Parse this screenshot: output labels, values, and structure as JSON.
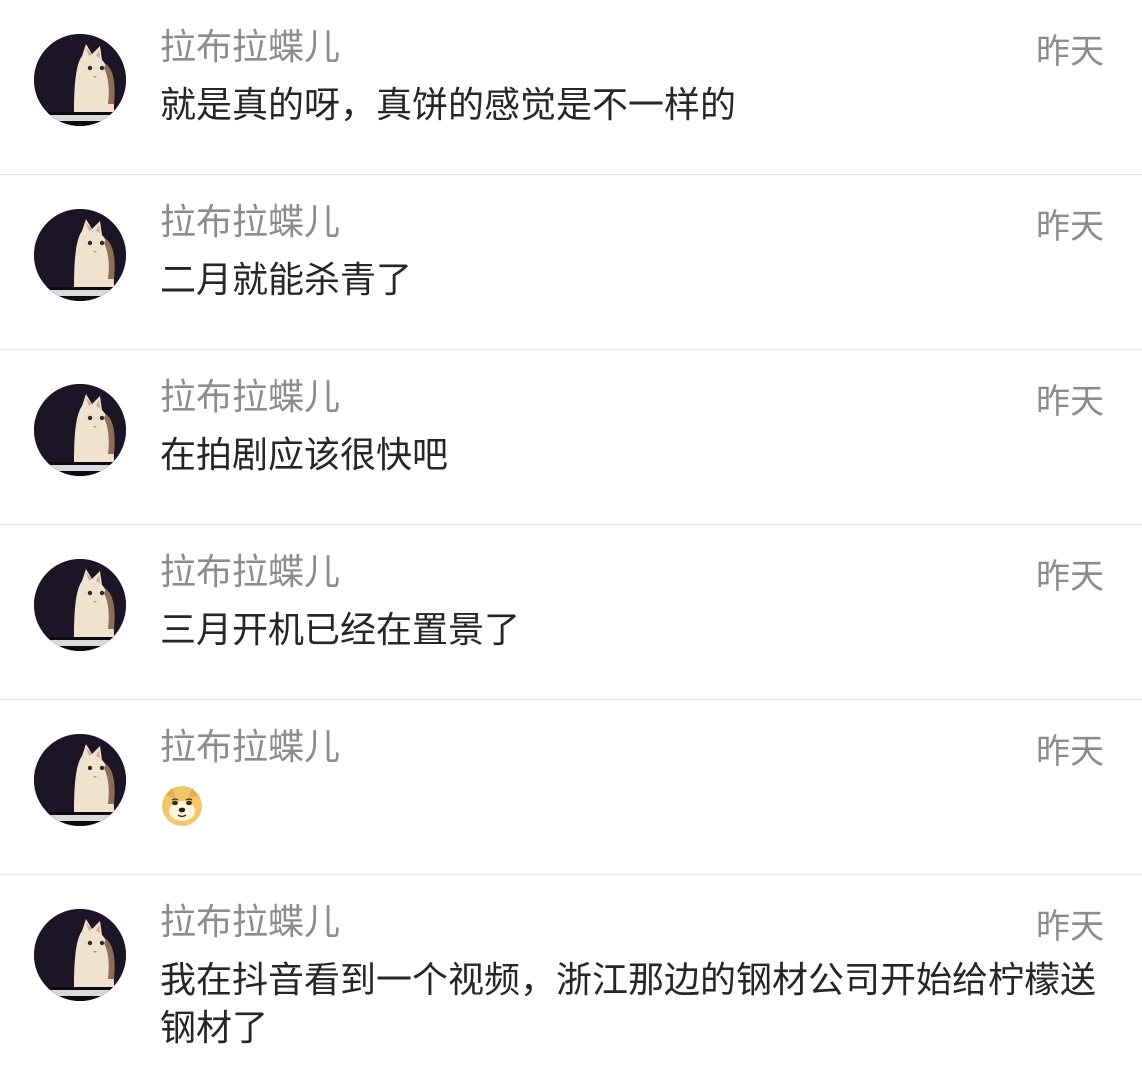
{
  "comments": [
    {
      "sender": "拉布拉蝶儿",
      "time": "昨天",
      "message": "就是真的呀，真饼的感觉是不一样的",
      "avatar_icon": "cat-avatar-icon"
    },
    {
      "sender": "拉布拉蝶儿",
      "time": "昨天",
      "message": "二月就能杀青了",
      "avatar_icon": "cat-avatar-icon"
    },
    {
      "sender": "拉布拉蝶儿",
      "time": "昨天",
      "message": "在拍剧应该很快吧",
      "avatar_icon": "cat-avatar-icon"
    },
    {
      "sender": "拉布拉蝶儿",
      "time": "昨天",
      "message": "三月开机已经在置景了",
      "avatar_icon": "cat-avatar-icon"
    },
    {
      "sender": "拉布拉蝶儿",
      "time": "昨天",
      "message": "",
      "message_icon": "doge-emoji-icon",
      "avatar_icon": "cat-avatar-icon"
    },
    {
      "sender": "拉布拉蝶儿",
      "time": "昨天",
      "message": "我在抖音看到一个视频，浙江那边的钢材公司开始给柠檬送钢材了",
      "avatar_icon": "cat-avatar-icon"
    }
  ],
  "colors": {
    "background": "#ffffff",
    "sender_text": "#8c8c8c",
    "time_text": "#8c8c8c",
    "message_text": "#262626",
    "divider": "#e3e3e3",
    "avatar_background": "#1c1526"
  }
}
